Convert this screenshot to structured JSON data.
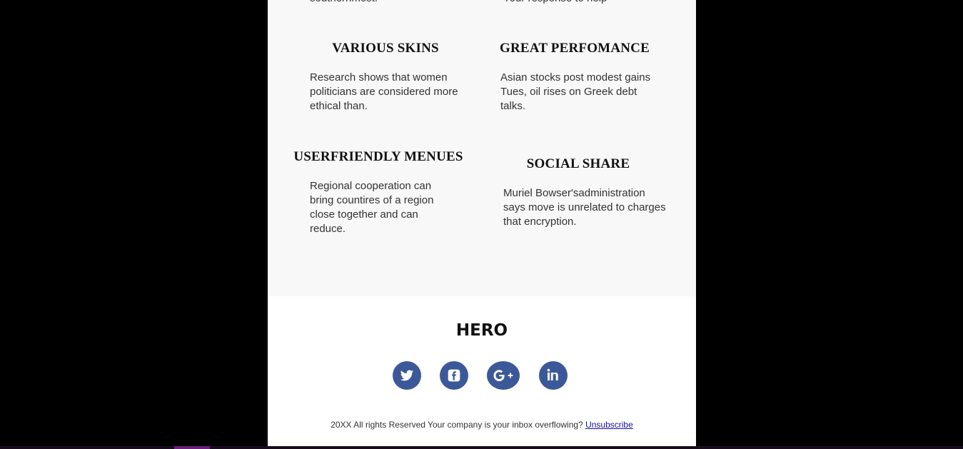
{
  "clipped_top": {
    "left_fragment": "southernmost.",
    "right_fragment": "Your response to help"
  },
  "features": [
    {
      "title": "VARIOUS SKINS",
      "desc_lines": [
        "Research shows that women",
        "politicians are considered more",
        "ethical than."
      ]
    },
    {
      "title": "GREAT PERFOMANCE",
      "desc_lines": [
        "Asian stocks post modest gains",
        "Tues, oil rises on Greek debt",
        "talks."
      ]
    },
    {
      "title": "USERFRIENDLY MENUES",
      "desc_lines": [
        "Regional cooperation can",
        "bring countires of a region",
        "close together and can",
        "reduce."
      ]
    },
    {
      "title": "SOCIAL SHARE",
      "desc_lines": [
        "Muriel Bowser'sadministration",
        "says move is unrelated to charges",
        "that encryption."
      ]
    }
  ],
  "hero": {
    "title": "HERO"
  },
  "social_links": [
    {
      "name": "twitter",
      "icon": "twitter-icon"
    },
    {
      "name": "facebook",
      "icon": "facebook-icon"
    },
    {
      "name": "google-plus",
      "icon": "google-plus-icon"
    },
    {
      "name": "linkedin",
      "icon": "linkedin-icon"
    }
  ],
  "footer": {
    "text": "20XX All rights Reserved Your company is your inbox overflowing?",
    "unsubscribe_label": "Unsubscribe"
  },
  "colors": {
    "page_background": "#000000",
    "features_background": "#f8f8f8",
    "social_icon_background": "#3b5998",
    "link": "#1a0dab"
  }
}
